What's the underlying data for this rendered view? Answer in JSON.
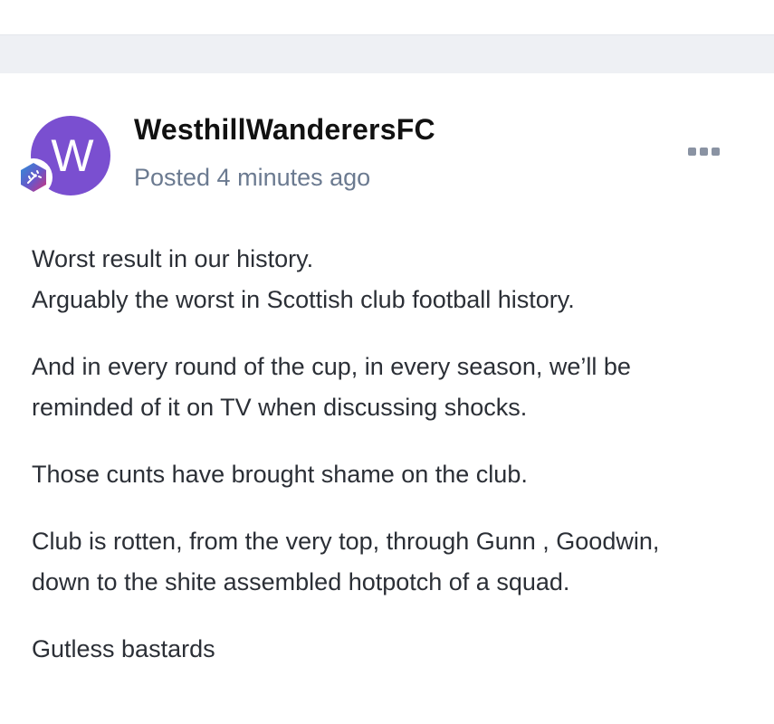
{
  "post": {
    "author": "WesthillWanderersFC",
    "avatar_letter": "W",
    "avatar_color": "#7a4fd0",
    "badge_icon": "rank-badge-icon",
    "meta": "Posted 4 minutes ago",
    "more_icon": "ellipsis-icon",
    "paragraphs": [
      [
        "Worst result in our history.",
        "Arguably the worst in Scottish club football history."
      ],
      [
        "And in every round of the cup, in every season, we’ll be",
        "reminded of it on TV when discussing shocks."
      ],
      [
        "Those cunts have brought shame on the club."
      ],
      [
        "Club is rotten, from the very top, through Gunn , Goodwin,",
        "down to the shite assembled hotpotch of a squad."
      ],
      [
        "Gutless bastards"
      ]
    ]
  }
}
